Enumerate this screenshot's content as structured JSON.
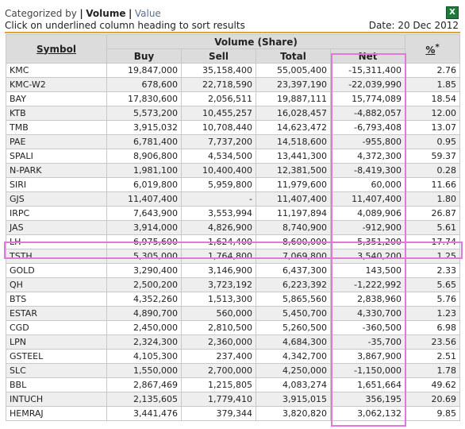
{
  "header": {
    "categorized_by": "Categorized by",
    "separator": "|",
    "active_tab": "Volume",
    "other_tab": "Value",
    "hint": "Click on underlined column heading to sort results",
    "date": "Date: 20 Dec 2012",
    "export_icon": "excel-icon"
  },
  "table": {
    "col_symbol": "Symbol",
    "group_label": "Volume (Share)",
    "col_buy": "Buy",
    "col_sell": "Sell",
    "col_total": "Total",
    "col_net": "Net",
    "col_pct": "%",
    "col_pct_sup": "*",
    "rows": [
      [
        "KMC",
        "19,847,000",
        "35,158,400",
        "55,005,400",
        "-15,311,400",
        "2.76"
      ],
      [
        "KMC-W2",
        "678,600",
        "22,718,590",
        "23,397,190",
        "-22,039,990",
        "1.85"
      ],
      [
        "BAY",
        "17,830,600",
        "2,056,511",
        "19,887,111",
        "15,774,089",
        "18.54"
      ],
      [
        "KTB",
        "5,573,200",
        "10,455,257",
        "16,028,457",
        "-4,882,057",
        "12.00"
      ],
      [
        "TMB",
        "3,915,032",
        "10,708,440",
        "14,623,472",
        "-6,793,408",
        "13.07"
      ],
      [
        "PAE",
        "6,781,400",
        "7,737,200",
        "14,518,600",
        "-955,800",
        "0.95"
      ],
      [
        "SPALI",
        "8,906,800",
        "4,534,500",
        "13,441,300",
        "4,372,300",
        "59.37"
      ],
      [
        "N-PARK",
        "1,981,100",
        "10,400,400",
        "12,381,500",
        "-8,419,300",
        "0.28"
      ],
      [
        "SIRI",
        "6,019,800",
        "5,959,800",
        "11,979,600",
        "60,000",
        "11.66"
      ],
      [
        "GJS",
        "11,407,400",
        "-",
        "11,407,400",
        "11,407,400",
        "1.80"
      ],
      [
        "IRPC",
        "7,643,900",
        "3,553,994",
        "11,197,894",
        "4,089,906",
        "26.87"
      ],
      [
        "JAS",
        "3,914,000",
        "4,826,900",
        "8,740,900",
        "-912,900",
        "5.61"
      ],
      [
        "LH",
        "6,975,600",
        "1,624,400",
        "8,600,000",
        "5,351,200",
        "17.74"
      ],
      [
        "TSTH",
        "5,305,000",
        "1,764,800",
        "7,069,800",
        "3,540,200",
        "1.25"
      ],
      [
        "GOLD",
        "3,290,400",
        "3,146,900",
        "6,437,300",
        "143,500",
        "2.33"
      ],
      [
        "QH",
        "2,500,200",
        "3,723,192",
        "6,223,392",
        "-1,222,992",
        "5.65"
      ],
      [
        "BTS",
        "4,352,260",
        "1,513,300",
        "5,865,560",
        "2,838,960",
        "5.76"
      ],
      [
        "ESTAR",
        "4,890,700",
        "560,000",
        "5,450,700",
        "4,330,700",
        "1.23"
      ],
      [
        "CGD",
        "2,450,000",
        "2,810,500",
        "5,260,500",
        "-360,500",
        "6.98"
      ],
      [
        "LPN",
        "2,324,300",
        "2,360,000",
        "4,684,300",
        "-35,700",
        "23.56"
      ],
      [
        "GSTEEL",
        "4,105,300",
        "237,400",
        "4,342,700",
        "3,867,900",
        "2.51"
      ],
      [
        "SLC",
        "1,550,000",
        "2,700,000",
        "4,250,000",
        "-1,150,000",
        "1.78"
      ],
      [
        "BBL",
        "2,867,469",
        "1,215,805",
        "4,083,274",
        "1,651,664",
        "49.62"
      ],
      [
        "INTUCH",
        "2,135,605",
        "1,779,410",
        "3,915,015",
        "356,195",
        "20.69"
      ],
      [
        "HEMRAJ",
        "3,441,476",
        "379,344",
        "3,820,820",
        "3,062,132",
        "9.85"
      ]
    ]
  },
  "highlight_color": "#e07ad8"
}
